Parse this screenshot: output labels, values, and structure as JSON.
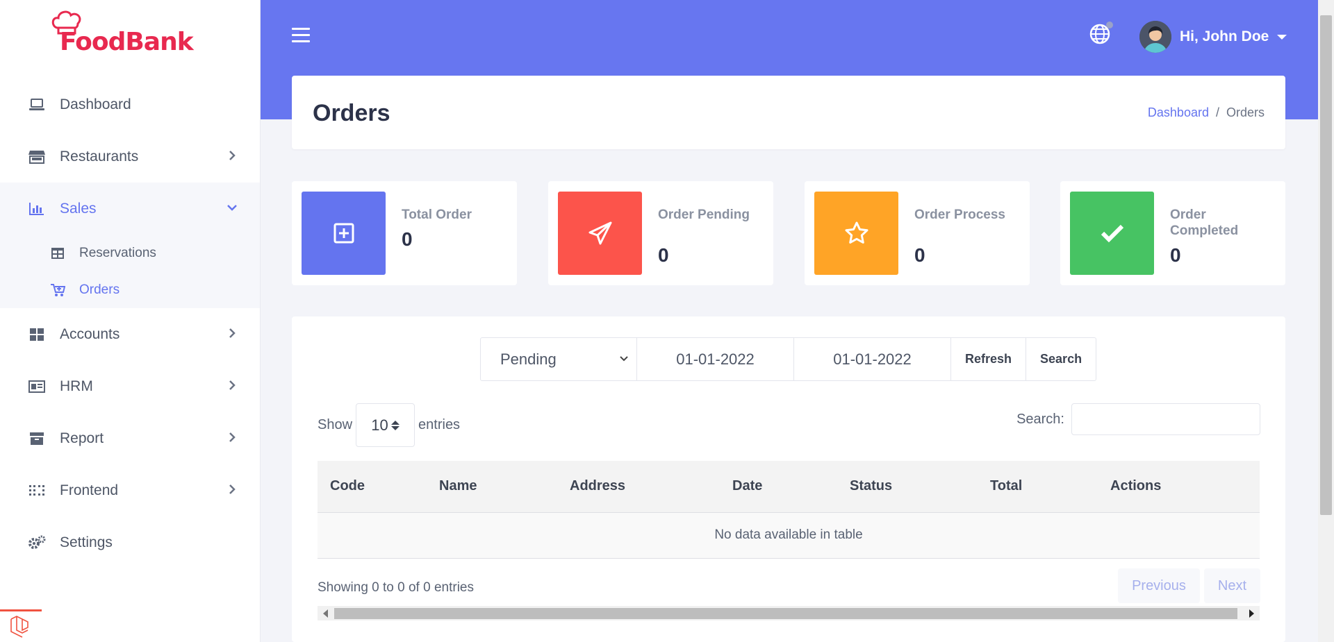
{
  "brand": {
    "name": "FoodBank"
  },
  "sidebar": {
    "items": [
      {
        "label": "Dashboard",
        "icon": "laptop-icon"
      },
      {
        "label": "Restaurants",
        "icon": "store-icon"
      },
      {
        "label": "Sales",
        "icon": "chart-bar-icon"
      },
      {
        "label": "Accounts",
        "icon": "grid-icon"
      },
      {
        "label": "HRM",
        "icon": "id-card-icon"
      },
      {
        "label": "Report",
        "icon": "archive-icon"
      },
      {
        "label": "Frontend",
        "icon": "dots-grid-icon"
      },
      {
        "label": "Settings",
        "icon": "gears-icon"
      }
    ],
    "sales_sub": [
      {
        "label": "Reservations",
        "icon": "table-icon"
      },
      {
        "label": "Orders",
        "icon": "cart-icon"
      }
    ]
  },
  "header": {
    "user_greeting": "Hi, John Doe"
  },
  "page": {
    "title": "Orders",
    "breadcrumb": {
      "home": "Dashboard",
      "separator": "/",
      "current": "Orders"
    }
  },
  "stats": [
    {
      "label": "Total Order",
      "value": "0",
      "color": "#6474ef",
      "icon": "plus-square-icon"
    },
    {
      "label": "Order Pending",
      "value": "0",
      "color": "#fc544b",
      "icon": "paper-plane-icon"
    },
    {
      "label": "Order Process",
      "value": "0",
      "color": "#ffa426",
      "icon": "star-icon"
    },
    {
      "label": "Order Completed",
      "value": "0",
      "color": "#47c363",
      "icon": "check-icon"
    }
  ],
  "filter": {
    "status": "Pending",
    "date_from": "01-01-2022",
    "date_to": "01-01-2022",
    "refresh_label": "Refresh",
    "search_label": "Search"
  },
  "table": {
    "show_label": "Show",
    "page_length": "10",
    "entries_label": "entries",
    "search_label": "Search:",
    "columns": [
      "Code",
      "Name",
      "Address",
      "Date",
      "Status",
      "Total",
      "Actions"
    ],
    "empty_message": "No data available in table",
    "info": "Showing 0 to 0 of 0 entries",
    "prev_label": "Previous",
    "next_label": "Next"
  }
}
